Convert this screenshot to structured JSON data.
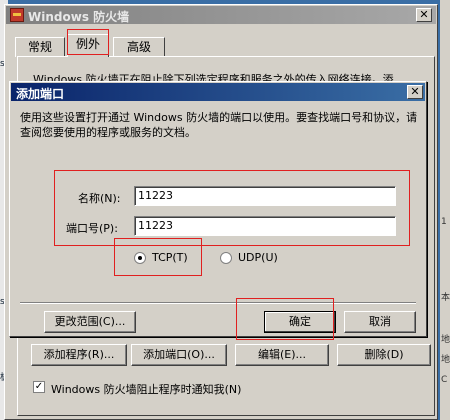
{
  "window": {
    "title": "Windows 防火墙",
    "close_glyph": "✕",
    "tabs": [
      {
        "label": "常规"
      },
      {
        "label": "例外"
      },
      {
        "label": "高级"
      }
    ],
    "description": "Windows 防火墙正在阻止除下列选定程序和服务之外的传入网络连接。添",
    "buttons": {
      "add_program": "添加程序(R)...",
      "add_port": "添加端口(O)...",
      "edit": "编辑(E)...",
      "delete": "删除(D)"
    },
    "notify_checkbox": {
      "label": "Windows 防火墙阻止程序时通知我(N)",
      "checked": true,
      "mark": "✓"
    }
  },
  "dialog": {
    "title": "添加端口",
    "close_glyph": "✕",
    "description": "使用这些设置打开通过 Windows 防火墙的端口以使用。要查找端口号和协议，请查阅您要使用的程序或服务的文档。",
    "name_label": "名称(N):",
    "name_value": "11223",
    "port_label": "端口号(P):",
    "port_value": "11223",
    "protocol_options": [
      {
        "label": "TCP(T)",
        "selected": true
      },
      {
        "label": "UDP(U)",
        "selected": false
      }
    ],
    "change_scope_button": "更改范围(C)...",
    "ok_button": "确定",
    "cancel_button": "取消"
  },
  "desktop_right_marks": [
    "1",
    "本",
    "地",
    "地",
    "C"
  ],
  "desktop_left_marks": [
    "s",
    "s",
    "板"
  ]
}
